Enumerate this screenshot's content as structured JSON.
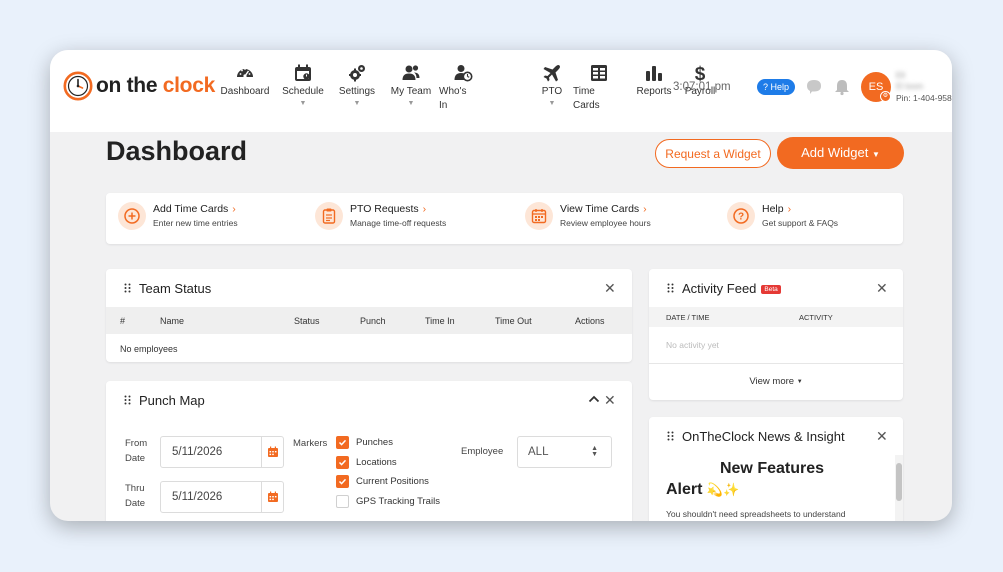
{
  "brand": {
    "logo_on": "on",
    "logo_the": "the",
    "logo_clock": "clock"
  },
  "nav": [
    {
      "label": "Dashboard",
      "icon": "gauge-icon"
    },
    {
      "label": "Schedule",
      "icon": "calendar-icon",
      "caret": "▼"
    },
    {
      "label": "Settings",
      "icon": "gears-icon",
      "caret": "▼"
    },
    {
      "label": "My Team",
      "icon": "team-icon",
      "caret": "▼"
    },
    {
      "label": "Who's",
      "label2": "In",
      "icon": "user-clock-icon"
    },
    {
      "label": "PTO",
      "icon": "plane-icon",
      "caret": "▼"
    },
    {
      "label": "Time",
      "label2": "Cards",
      "icon": "table-icon"
    },
    {
      "label": "Reports",
      "icon": "bar-chart-icon"
    },
    {
      "label": "Payroll",
      "icon": "dollar-icon"
    }
  ],
  "header": {
    "time": "3:07:01 pm",
    "help_label": "? Help",
    "avatar_initials": "ES",
    "user_name_line1": "Ell",
    "user_name_line2": "El Ioom",
    "pin": "Pin: 1-404-958"
  },
  "page": {
    "title": "Dashboard",
    "request_widget": "Request a Widget",
    "add_widget": "Add Widget"
  },
  "quick_actions": [
    {
      "title": "Add Time Cards",
      "sub": "Enter new time entries",
      "icon": "plus-circle-icon"
    },
    {
      "title": "PTO Requests",
      "sub": "Manage time-off requests",
      "icon": "clipboard-icon"
    },
    {
      "title": "View Time Cards",
      "sub": "Review employee hours",
      "icon": "calendar-grid-icon"
    },
    {
      "title": "Help",
      "sub": "Get support & FAQs",
      "icon": "question-icon"
    }
  ],
  "team_status": {
    "title": "Team Status",
    "columns": [
      "#",
      "Name",
      "Status",
      "Punch",
      "Time In",
      "Time Out",
      "Actions"
    ],
    "empty": "No employees"
  },
  "activity_feed": {
    "title": "Activity Feed",
    "badge": "Beta",
    "columns": [
      "DATE / TIME",
      "ACTIVITY"
    ],
    "empty": "No activity yet",
    "view_more": "View more"
  },
  "punch_map": {
    "title": "Punch Map",
    "from_label": "From Date",
    "from_label_1": "From",
    "from_label_2": "Date",
    "from_value": "5/11/2026",
    "thru_label_1": "Thru",
    "thru_label_2": "Date",
    "thru_value": "5/11/2026",
    "markers_label": "Markers",
    "markers": [
      {
        "label": "Punches",
        "checked": true
      },
      {
        "label": "Locations",
        "checked": true
      },
      {
        "label": "Current Positions",
        "checked": true
      },
      {
        "label": "GPS Tracking Trails",
        "checked": false
      }
    ],
    "employee_label": "Employee",
    "employee_value": "ALL"
  },
  "news": {
    "title": "OnTheClock News & Insight",
    "headline_1": "New Features",
    "headline_2": "Alert",
    "headline_emoji": "💫✨",
    "body": "You shouldn't need spreadsheets to understand"
  },
  "colors": {
    "accent": "#f26a21",
    "help_blue": "#1e7ce8",
    "beta_red": "#e53935"
  }
}
